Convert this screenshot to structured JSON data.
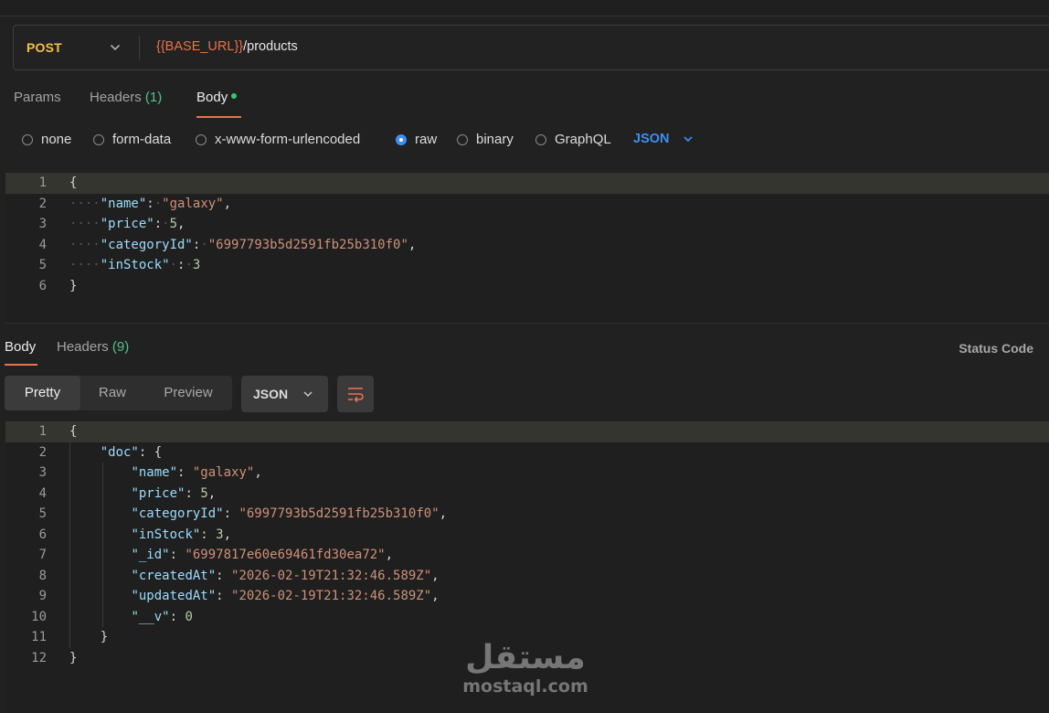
{
  "request": {
    "method": "POST",
    "url_variable": "{{BASE_URL}}",
    "url_path": "/products"
  },
  "request_tabs": {
    "params": "Params",
    "headers": "Headers",
    "headers_count": "(1)",
    "body": "Body"
  },
  "body_types": {
    "none": "none",
    "form_data": "form-data",
    "urlencoded": "x-www-form-urlencoded",
    "raw": "raw",
    "binary": "binary",
    "graphql": "GraphQL",
    "selected": "raw",
    "language": "JSON"
  },
  "request_body_lines": [
    "1",
    "2",
    "3",
    "4",
    "5",
    "6"
  ],
  "request_body": {
    "l1": "{",
    "name_key": "\"name\"",
    "name_val": "\"galaxy\"",
    "price_key": "\"price\"",
    "price_val": "5",
    "category_key": "\"categoryId\"",
    "category_val": "\"6997793b5d2591fb25b310f0\"",
    "stock_key": "\"inStock\"",
    "stock_val": "3",
    "l6": "}"
  },
  "response_tabs": {
    "body": "Body",
    "headers": "Headers",
    "headers_count": "(9)",
    "status_code": "Status Code"
  },
  "response_view": {
    "pretty": "Pretty",
    "raw": "Raw",
    "preview": "Preview",
    "format": "JSON"
  },
  "response_body_lines": [
    "1",
    "2",
    "3",
    "4",
    "5",
    "6",
    "7",
    "8",
    "9",
    "10",
    "11",
    "12"
  ],
  "response_body": {
    "l1": "{",
    "doc_key": "\"doc\"",
    "name_key": "\"name\"",
    "name_val": "\"galaxy\"",
    "price_key": "\"price\"",
    "price_val": "5",
    "category_key": "\"categoryId\"",
    "category_val": "\"6997793b5d2591fb25b310f0\"",
    "stock_key": "\"inStock\"",
    "stock_val": "3",
    "id_key": "\"_id\"",
    "id_val": "\"6997817e60e69461fd30ea72\"",
    "created_key": "\"createdAt\"",
    "created_val": "\"2026-02-19T21:32:46.589Z\"",
    "updated_key": "\"updatedAt\"",
    "updated_val": "\"2026-02-19T21:32:46.589Z\"",
    "v_key": "\"__v\"",
    "v_val": "0",
    "l11": "}",
    "l12": "}"
  },
  "watermark": {
    "arabic": "مستقل",
    "latin": "mostaql.com"
  },
  "colors": {
    "method": "#f5c242",
    "accent": "#e8734a",
    "selected_blue": "#3e8ff5",
    "count_green": "#4fc48a",
    "json_key": "#9cdcfe",
    "json_string": "#ce9178",
    "json_number": "#b5cea8"
  },
  "icons": {
    "method_dropdown": "chevron-down-icon",
    "language_dropdown": "chevron-down-icon",
    "format_dropdown": "chevron-down-icon",
    "wrap": "wrap-lines-icon"
  }
}
